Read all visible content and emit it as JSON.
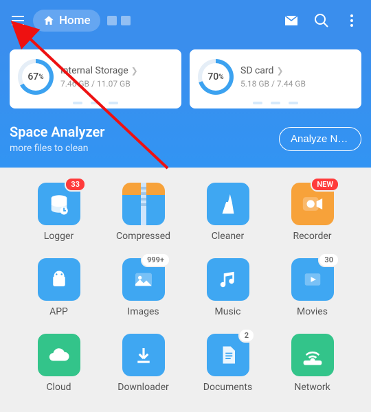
{
  "toolbar": {
    "home_label": "Home"
  },
  "storage": {
    "internal": {
      "title": "Internal Storage",
      "sub": "7.46 GB / 11.07 GB",
      "pct": "67",
      "pct_unit": "%",
      "fill": 67
    },
    "sd": {
      "title": "SD card",
      "sub": "5.18 GB / 7.44 GB",
      "pct": "70",
      "pct_unit": "%",
      "fill": 70
    }
  },
  "analyzer": {
    "title": "Space Analyzer",
    "subtitle": "more files to clean",
    "button": "Analyze No…"
  },
  "tiles": {
    "logger": {
      "label": "Logger",
      "badge": "33"
    },
    "compressed": {
      "label": "Compressed"
    },
    "cleaner": {
      "label": "Cleaner"
    },
    "recorder": {
      "label": "Recorder",
      "badge": "NEW"
    },
    "app": {
      "label": "APP"
    },
    "images": {
      "label": "Images",
      "badge": "999+"
    },
    "music": {
      "label": "Music"
    },
    "movies": {
      "label": "Movies",
      "badge": "30"
    },
    "cloud": {
      "label": "Cloud"
    },
    "downloader": {
      "label": "Downloader"
    },
    "documents": {
      "label": "Documents",
      "badge": "2"
    },
    "network": {
      "label": "Network"
    }
  },
  "colors": {
    "primary": "#3a8eed",
    "badge_red": "#ff3b3b"
  }
}
